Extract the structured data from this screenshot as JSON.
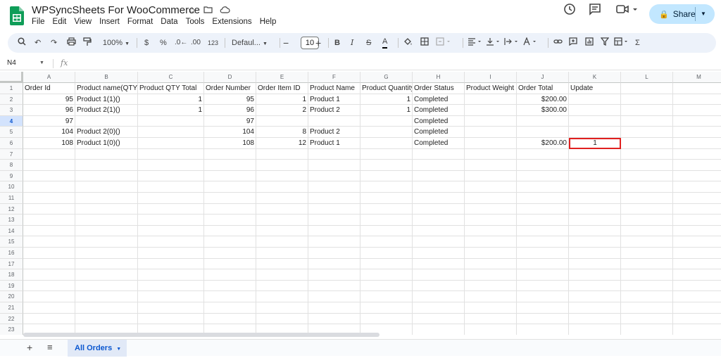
{
  "app": {
    "title": "WPSyncSheets For WooCommerce",
    "menus": [
      "File",
      "Edit",
      "View",
      "Insert",
      "Format",
      "Data",
      "Tools",
      "Extensions",
      "Help"
    ],
    "share_label": "Share"
  },
  "toolbar": {
    "zoom": "100%",
    "currency": "$",
    "percent": "%",
    "dec_decrease": ".0←",
    "dec_increase": ".00",
    "number_format": "123",
    "font": "Defaul...",
    "font_size": "10",
    "bold": "B",
    "italic": "I",
    "strike": "S",
    "text_color": "A"
  },
  "formula_bar": {
    "name_box": "N4",
    "fx": "fx"
  },
  "sheet": {
    "columns": [
      "A",
      "B",
      "C",
      "D",
      "E",
      "F",
      "G",
      "H",
      "I",
      "J",
      "K",
      "L",
      "M"
    ],
    "row_numbers": [
      "1",
      "2",
      "3",
      "4",
      "5",
      "6",
      "7",
      "8",
      "9",
      "10",
      "11",
      "12",
      "13",
      "14",
      "15",
      "16",
      "17",
      "18",
      "19",
      "20",
      "21",
      "22",
      "23"
    ],
    "active_row": "4",
    "rows": [
      [
        "Order Id",
        "Product name(QTY)",
        "Product QTY Total",
        "Order Number",
        "Order Item ID",
        "Product Name",
        "Product Quantity",
        "Order Status",
        "Product Weight",
        "Order Total",
        "Update",
        "",
        ""
      ],
      [
        "95",
        "Product 1(1)()",
        "1",
        "95",
        "1",
        "Product 1",
        "1",
        "Completed",
        "",
        "$200.00",
        "",
        "",
        ""
      ],
      [
        "96",
        "Product 2(1)()",
        "1",
        "96",
        "2",
        "Product 2",
        "1",
        "Completed",
        "",
        "$300.00",
        "",
        "",
        ""
      ],
      [
        "97",
        "",
        "",
        "97",
        "",
        "",
        "",
        "Completed",
        "",
        "",
        "",
        "",
        ""
      ],
      [
        "104",
        "Product 2(0)()",
        "",
        "104",
        "8",
        "Product 2",
        "",
        "Completed",
        "",
        "",
        "",
        "",
        ""
      ],
      [
        "108",
        "Product 1(0)()",
        "",
        "108",
        "12",
        "Product 1",
        "",
        "Completed",
        "",
        "$200.00",
        "1",
        "",
        ""
      ]
    ],
    "highlight_cell": {
      "row": 5,
      "col": 10
    }
  },
  "tabs": [
    {
      "label": "All Orders"
    }
  ]
}
